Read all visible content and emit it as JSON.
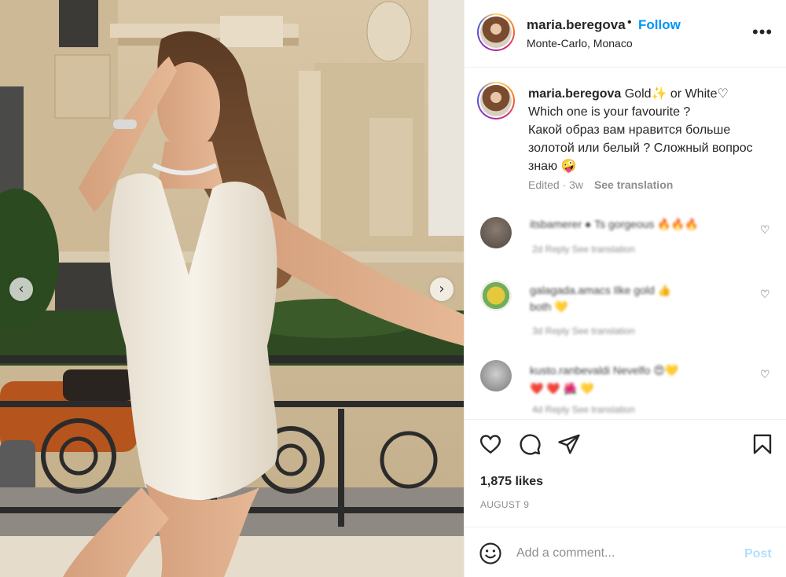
{
  "post": {
    "username": "maria.beregova",
    "separator": "•",
    "follow_label": "Follow",
    "location": "Monte-Carlo, Monaco",
    "more_label": "•••"
  },
  "caption": {
    "username": "maria.beregova",
    "text": " Gold✨ or White♡\nWhich one is your favourite ?\nКакой образ вам нравится больше золотой или белый ? Сложный вопрос знаю 🤪",
    "edited": "Edited · 3w",
    "see_translation": "See translation"
  },
  "comments": [
    {
      "text": "itsbamerer ● Ts gorgeous 🔥🔥🔥",
      "sub": "2d   Reply   See translation",
      "avatar_color": "#6b6560"
    },
    {
      "text": "galagada.amacs Ilke gold 👍",
      "text2": "both 💛",
      "sub": "3d   Reply   See translation",
      "avatar_color": "#e6c93a"
    },
    {
      "text": "kusto.ranbevaldi Nevelfo 😍💛",
      "text2": "❤️ ❤️ 🌺 💛",
      "sub": "4d   Reply   See translation",
      "avatar_color": "#9c9c9c"
    }
  ],
  "actions": {
    "like_icon": "heart-icon",
    "comment_icon": "comment-icon",
    "share_icon": "share-icon",
    "save_icon": "bookmark-icon"
  },
  "likes": "1,875 likes",
  "date": "AUGUST 9",
  "add_comment": {
    "placeholder": "Add a comment...",
    "post_label": "Post"
  },
  "carousel": {
    "prev_label": "‹",
    "next_label": "›"
  },
  "colors": {
    "accent": "#0095f6",
    "post_disabled": "#b2dffc",
    "muted": "#8e8e8e"
  }
}
